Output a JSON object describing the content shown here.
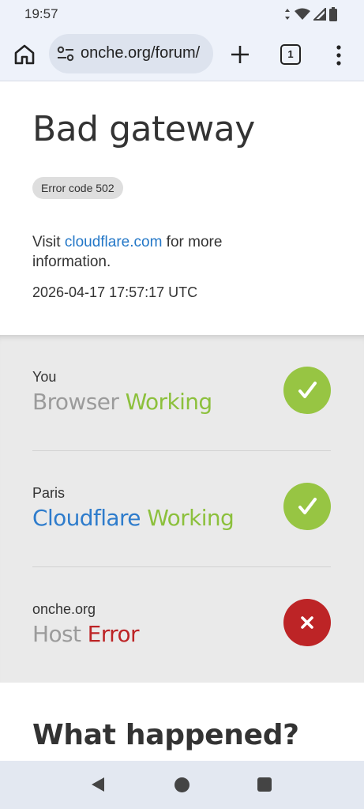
{
  "status_bar": {
    "time": "19:57",
    "icons": [
      "data-arrows-icon",
      "wifi-icon",
      "signal-icon",
      "battery-icon"
    ]
  },
  "browser": {
    "url": "onche.org/forum/",
    "tab_count": "1",
    "icons": [
      "home-icon",
      "site-settings-icon",
      "plus-icon",
      "tabs-icon",
      "more-vert-icon"
    ]
  },
  "page": {
    "headline": "Bad gateway",
    "error_code": "Error code 502",
    "info_prefix": "Visit ",
    "info_link": "cloudflare.com",
    "info_suffix": " for more information.",
    "timestamp": "2026-04-17 17:57:17 UTC",
    "statuses": [
      {
        "location": "You",
        "name": "Browser",
        "status": "Working",
        "icon": "check-icon"
      },
      {
        "location": "Paris",
        "name": "Cloudflare",
        "status": "Working",
        "icon": "check-icon"
      },
      {
        "location": "onche.org",
        "name": "Host",
        "status": "Error",
        "icon": "close-icon"
      }
    ],
    "section_title": "What happened?"
  },
  "colors": {
    "working": "#8cc03c",
    "error": "#bd2426",
    "link": "#2377c7",
    "cloudflare_name": "#2e7ccc"
  },
  "nav": {
    "icons": [
      "back-icon",
      "home-circle-icon",
      "recents-icon"
    ]
  }
}
